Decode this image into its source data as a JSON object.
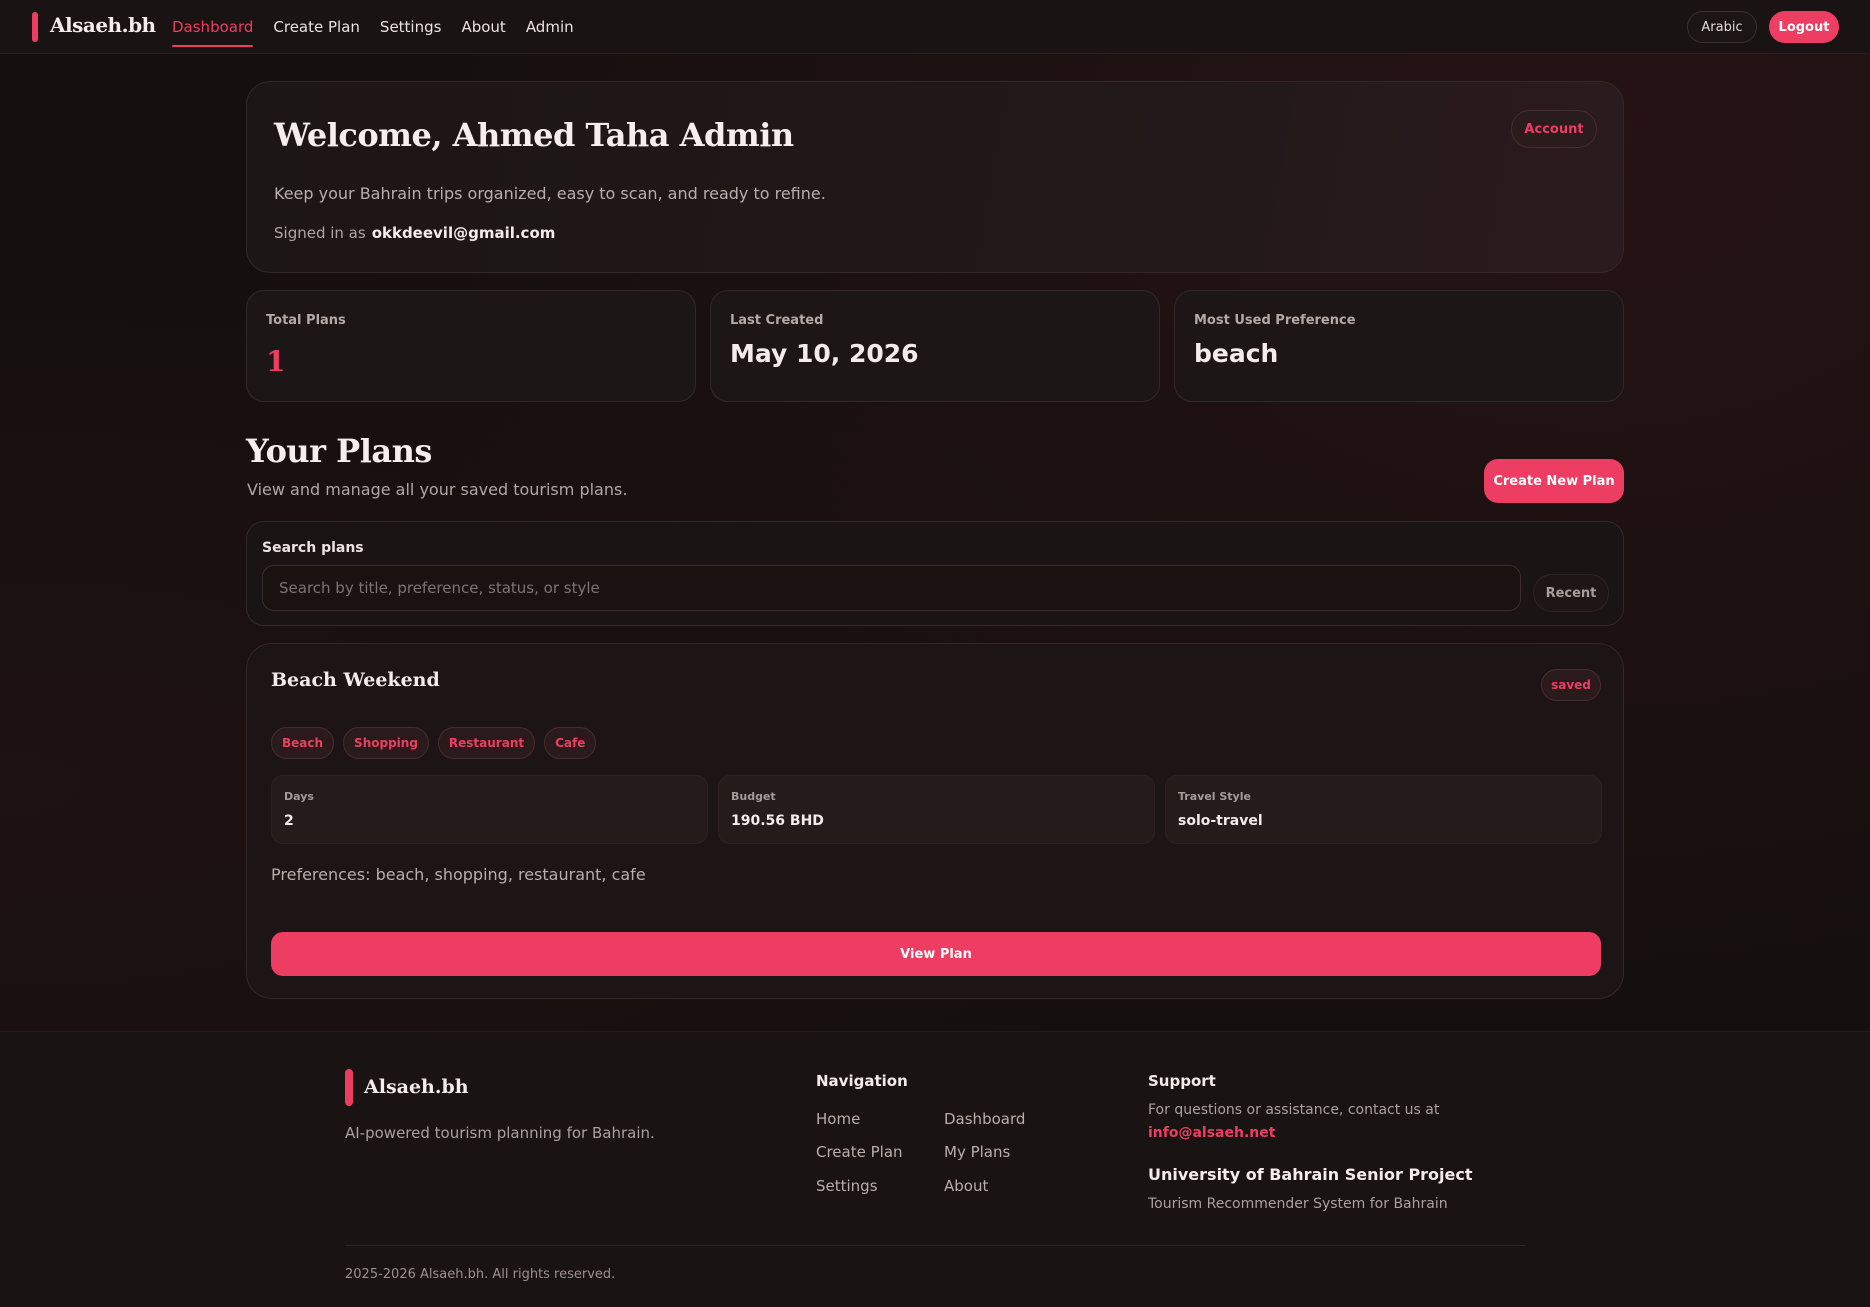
{
  "nav": {
    "brand": "Alsaeh.bh",
    "links": [
      "Dashboard",
      "Create Plan",
      "Settings",
      "About",
      "Admin"
    ],
    "active": "Dashboard",
    "language_label": "Arabic",
    "logout_label": "Logout"
  },
  "welcome": {
    "title": "Welcome, Ahmed Taha Admin",
    "subtitle": "Keep your Bahrain trips organized, easy to scan, and ready to refine.",
    "signed_in_label": "Signed in as",
    "email": "okkdeevil@gmail.com",
    "account_label": "Account"
  },
  "stats": [
    {
      "label": "Total Plans",
      "value": "1"
    },
    {
      "label": "Last Created",
      "value": "May 10, 2026"
    },
    {
      "label": "Most Used Preference",
      "value": "beach"
    }
  ],
  "plans": {
    "title": "Your Plans",
    "subtitle": "View and manage all your saved tourism plans.",
    "create_label": "Create New Plan",
    "search_label": "Search plans",
    "search_placeholder": "Search by title, preference, status, or style",
    "search_value": "",
    "sort_label": "Recent",
    "items": [
      {
        "title": "Beach Weekend",
        "status": "saved",
        "tags": [
          "Beach",
          "Shopping",
          "Restaurant",
          "Cafe"
        ],
        "metrics": [
          {
            "label": "Days",
            "value": "2"
          },
          {
            "label": "Budget",
            "value": "190.56 BHD"
          },
          {
            "label": "Travel Style",
            "value": "solo-travel"
          }
        ],
        "preferences": "Preferences: beach, shopping, restaurant, cafe",
        "view_label": "View Plan"
      }
    ]
  },
  "footer": {
    "brand": "Alsaeh.bh",
    "tagline": "AI-powered tourism planning for Bahrain.",
    "nav_title": "Navigation",
    "nav_links": [
      "Home",
      "Dashboard",
      "Create Plan",
      "My Plans",
      "Settings",
      "About"
    ],
    "support_title": "Support",
    "support_text": "For questions or assistance, contact us at",
    "support_email": "info@alsaeh.net",
    "project_title": "University of Bahrain Senior Project",
    "project_subtitle": "Tourism Recommender System for Bahrain",
    "copyright": "2025-2026 Alsaeh.bh. All rights reserved."
  },
  "colors": {
    "accent": "#ee3d62",
    "background": "#150f0f",
    "card": "#1d1616"
  }
}
